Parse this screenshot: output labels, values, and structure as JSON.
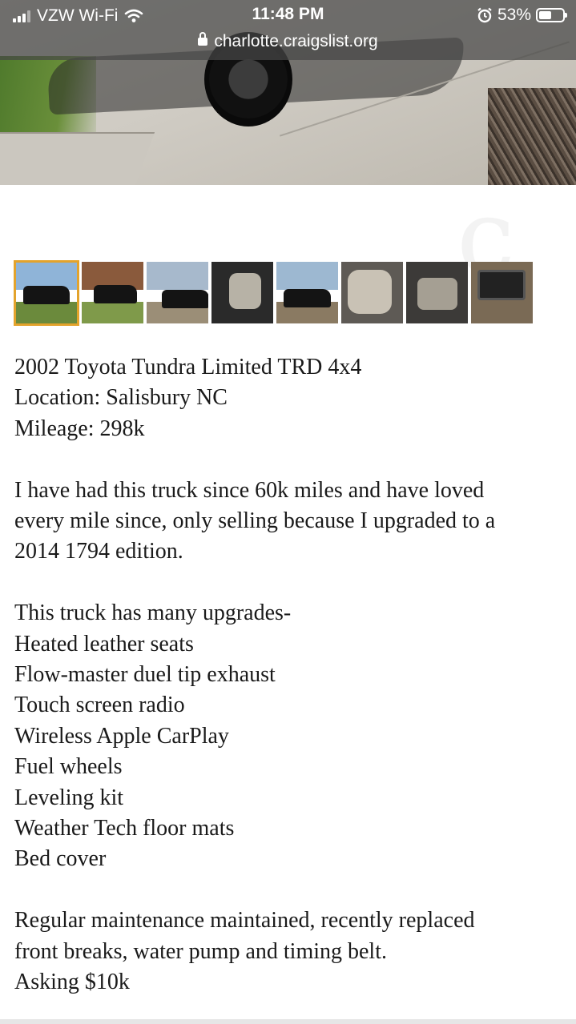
{
  "status_bar": {
    "carrier": "VZW Wi-Fi",
    "time": "11:48 PM",
    "battery": "53%",
    "battery_level": 0.53,
    "url": "charlotte.craigslist.org"
  },
  "gallery": {
    "selected_index": 0,
    "thumbnail_count": 8
  },
  "listing": {
    "title": "2002 Toyota Tundra Limited TRD 4x4",
    "location": "Location: Salisbury NC",
    "mileage": "Mileage: 298k",
    "intro": [
      "I have had this truck since 60k miles and have loved",
      "every mile since, only selling because I upgraded to a",
      "2014 1794 edition."
    ],
    "upgrades_heading": "This truck has many upgrades-",
    "upgrades": [
      "Heated leather seats",
      "Flow-master duel tip exhaust",
      "Touch screen radio",
      "Wireless Apple CarPlay",
      "Fuel wheels",
      "Leveling kit",
      "Weather Tech floor mats",
      "Bed cover"
    ],
    "maintenance": [
      "Regular maintenance maintained, recently replaced",
      "front breaks, water pump and timing belt."
    ],
    "price": "Asking $10k"
  },
  "icons": [
    "signal-icon",
    "wifi-icon",
    "alarm-icon",
    "battery-icon",
    "lock-icon"
  ]
}
